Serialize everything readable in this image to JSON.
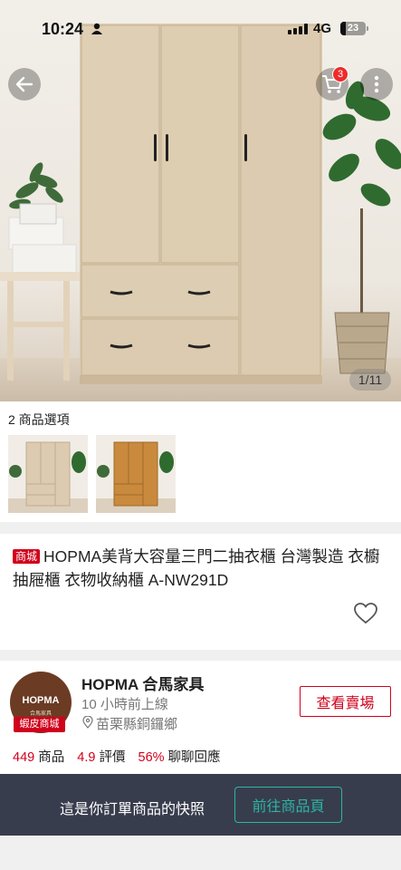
{
  "status_bar": {
    "time": "10:24",
    "network": "4G",
    "battery": "23",
    "battery_level": 0.23
  },
  "header": {
    "cart_count": "3"
  },
  "gallery": {
    "counter": "1/11"
  },
  "options": {
    "title": "2 商品選項"
  },
  "product": {
    "mall_badge": "商城",
    "title": "HOPMA美背大容量三門二抽衣櫃 台灣製造 衣櫥 抽屜櫃 衣物收納櫃 A-NW291D"
  },
  "shop": {
    "logo_text": "HOPMA",
    "logo_sub": "合馬家具",
    "mall_badge": "蝦皮商城",
    "name": "HOPMA 合馬家具",
    "online": "10 小時前上線",
    "location": "苗栗縣銅鑼鄉",
    "view_button": "查看賣場",
    "stats": {
      "products_value": "449",
      "products_label": "商品",
      "rating_value": "4.9",
      "rating_label": "評價",
      "chat_value": "56%",
      "chat_label": "聊聊回應"
    }
  },
  "snapshot": {
    "text": "這是你訂單商品的快照",
    "button": "前往商品頁"
  },
  "colors": {
    "brand_red": "#d0011b",
    "bar_bg": "#383d4d",
    "teal": "#2bb5a6",
    "wood": "#d9c8ad",
    "wood_orange": "#c98a3e"
  }
}
